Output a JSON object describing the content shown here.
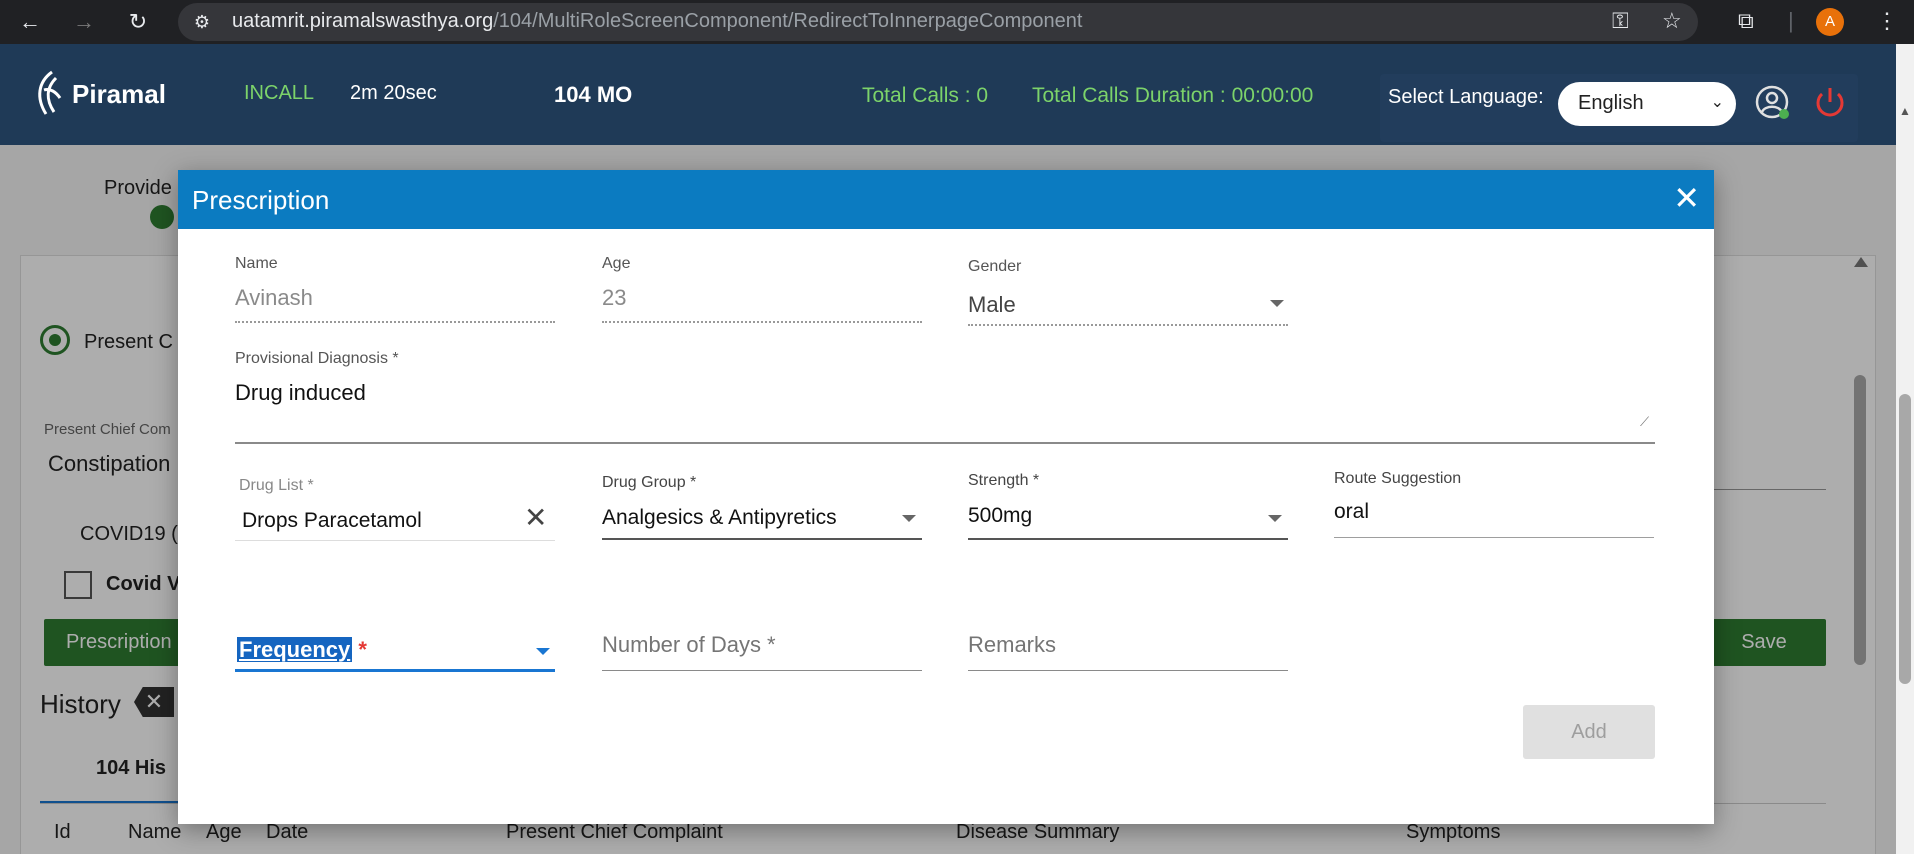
{
  "browser": {
    "url_host": "uatamrit.piramalswasthya.org",
    "url_path": "/104/MultiRoleScreenComponent/RedirectToInnerpageComponent",
    "profile_initial": "A"
  },
  "header": {
    "brand": "Piramal",
    "call_status": "INCALL",
    "call_timer": "2m 20sec",
    "role": "104 MO",
    "total_calls": "Total Calls : 0",
    "total_calls_duration": "Total Calls Duration : 00:00:00",
    "language_label": "Select Language:",
    "language_value": "English"
  },
  "background": {
    "provide": "Provide",
    "present_radio": "Present C",
    "present_chief_label": "Present Chief Com",
    "present_chief_value": "Constipation",
    "covid19": "COVID19 (",
    "covid_checkbox": "Covid V",
    "prescription_btn": "Prescription",
    "save_btn": "Save",
    "history": "History",
    "tab_104": "104 His",
    "columns": [
      "Id",
      "Name",
      "Age",
      "Date",
      "Present Chief Complaint",
      "Disease Summary",
      "Symptoms"
    ]
  },
  "modal": {
    "title": "Prescription",
    "name_label": "Name",
    "name_value": "Avinash",
    "age_label": "Age",
    "age_value": "23",
    "gender_label": "Gender",
    "gender_value": "Male",
    "diagnosis_label": "Provisional Diagnosis *",
    "diagnosis_value": "Drug induced",
    "drug_list_label": "Drug List *",
    "drug_list_value": "Drops Paracetamol",
    "drug_group_label": "Drug Group *",
    "drug_group_value": "Analgesics & Antipyretics",
    "strength_label": "Strength *",
    "strength_value": "500mg",
    "route_label": "Route Suggestion",
    "route_value": "oral",
    "frequency_placeholder": "Frequency",
    "frequency_required": "*",
    "days_placeholder": "Number of Days *",
    "remarks_placeholder": "Remarks",
    "add_btn": "Add"
  }
}
